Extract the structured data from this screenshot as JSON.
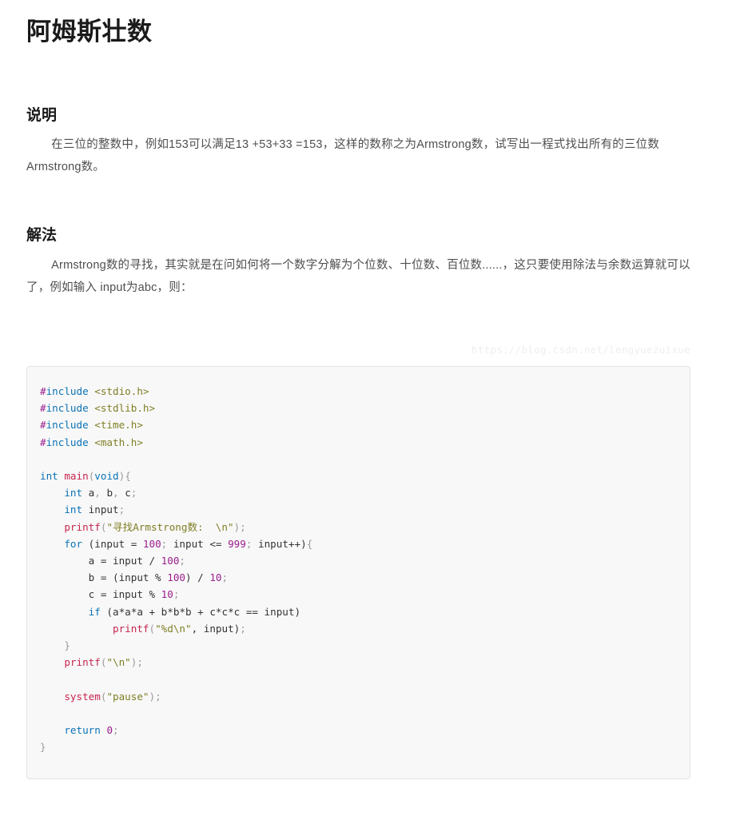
{
  "document": {
    "title": "阿姆斯壮数",
    "watermark": "https://blog.csdn.net/lengyuezuixue"
  },
  "sections": [
    {
      "heading": "说明",
      "paragraph": "在三位的整数中，例如153可以满足13 +53+33 =153，这样的数称之为Armstrong数，试写出一程式找出所有的三位数Armstrong数。"
    },
    {
      "heading": "解法",
      "paragraph": "Armstrong数的寻找，其实就是在问如何将一个数字分解为个位数、十位数、百位数......，这只要使用除法与余数运算就可以了，例如输入 input为abc，则："
    }
  ],
  "formula": {
    "line1": "a = input / 100",
    "line2": "b = (input%100) / 10",
    "line3": "c = input % 10"
  },
  "code": {
    "language": "c",
    "lines": [
      [
        {
          "t": "#",
          "c": "hash"
        },
        {
          "t": "include ",
          "c": "pre"
        },
        {
          "t": "<stdio.h>",
          "c": "inc"
        }
      ],
      [
        {
          "t": "#",
          "c": "hash"
        },
        {
          "t": "include ",
          "c": "pre"
        },
        {
          "t": "<stdlib.h>",
          "c": "inc"
        }
      ],
      [
        {
          "t": "#",
          "c": "hash"
        },
        {
          "t": "include ",
          "c": "pre"
        },
        {
          "t": "<time.h>",
          "c": "inc"
        }
      ],
      [
        {
          "t": "#",
          "c": "hash"
        },
        {
          "t": "include ",
          "c": "pre"
        },
        {
          "t": "<math.h>",
          "c": "inc"
        }
      ],
      [],
      [
        {
          "t": "int ",
          "c": "kw"
        },
        {
          "t": "main",
          "c": "fn"
        },
        {
          "t": "(",
          "c": "punct"
        },
        {
          "t": "void",
          "c": "kw"
        },
        {
          "t": ")",
          "c": "punct"
        },
        {
          "t": "{",
          "c": "brace"
        }
      ],
      [
        {
          "t": "    ",
          "c": "plain"
        },
        {
          "t": "int",
          "c": "kw"
        },
        {
          "t": " a",
          "c": "plain"
        },
        {
          "t": ",",
          "c": "punct"
        },
        {
          "t": " b",
          "c": "plain"
        },
        {
          "t": ",",
          "c": "punct"
        },
        {
          "t": " c",
          "c": "plain"
        },
        {
          "t": ";",
          "c": "punct"
        }
      ],
      [
        {
          "t": "    ",
          "c": "plain"
        },
        {
          "t": "int",
          "c": "kw"
        },
        {
          "t": " input",
          "c": "plain"
        },
        {
          "t": ";",
          "c": "punct"
        }
      ],
      [
        {
          "t": "    ",
          "c": "plain"
        },
        {
          "t": "printf",
          "c": "fn"
        },
        {
          "t": "(",
          "c": "punct"
        },
        {
          "t": "\"寻找Armstrong数:  \\n\"",
          "c": "str"
        },
        {
          "t": ")",
          "c": "punct"
        },
        {
          "t": ";",
          "c": "punct"
        }
      ],
      [
        {
          "t": "    ",
          "c": "plain"
        },
        {
          "t": "for",
          "c": "kw"
        },
        {
          "t": " (input = ",
          "c": "plain"
        },
        {
          "t": "100",
          "c": "num"
        },
        {
          "t": ";",
          "c": "punct"
        },
        {
          "t": " input <= ",
          "c": "plain"
        },
        {
          "t": "999",
          "c": "num"
        },
        {
          "t": ";",
          "c": "punct"
        },
        {
          "t": " input++)",
          "c": "plain"
        },
        {
          "t": "{",
          "c": "brace"
        }
      ],
      [
        {
          "t": "        a = input / ",
          "c": "plain"
        },
        {
          "t": "100",
          "c": "num"
        },
        {
          "t": ";",
          "c": "punct"
        }
      ],
      [
        {
          "t": "        b = (input % ",
          "c": "plain"
        },
        {
          "t": "100",
          "c": "num"
        },
        {
          "t": ") / ",
          "c": "plain"
        },
        {
          "t": "10",
          "c": "num"
        },
        {
          "t": ";",
          "c": "punct"
        }
      ],
      [
        {
          "t": "        c = input % ",
          "c": "plain"
        },
        {
          "t": "10",
          "c": "num"
        },
        {
          "t": ";",
          "c": "punct"
        }
      ],
      [
        {
          "t": "        ",
          "c": "plain"
        },
        {
          "t": "if",
          "c": "kw"
        },
        {
          "t": " (a*a*a + b*b*b + c*c*c == input)",
          "c": "plain"
        }
      ],
      [
        {
          "t": "            ",
          "c": "plain"
        },
        {
          "t": "printf",
          "c": "fn"
        },
        {
          "t": "(",
          "c": "punct"
        },
        {
          "t": "\"%d\\n\"",
          "c": "str"
        },
        {
          "t": ", input)",
          "c": "plain"
        },
        {
          "t": ";",
          "c": "punct"
        }
      ],
      [
        {
          "t": "    ",
          "c": "plain"
        },
        {
          "t": "}",
          "c": "brace"
        }
      ],
      [
        {
          "t": "    ",
          "c": "plain"
        },
        {
          "t": "printf",
          "c": "fn"
        },
        {
          "t": "(",
          "c": "punct"
        },
        {
          "t": "\"\\n\"",
          "c": "str"
        },
        {
          "t": ")",
          "c": "punct"
        },
        {
          "t": ";",
          "c": "punct"
        }
      ],
      [],
      [
        {
          "t": "    ",
          "c": "plain"
        },
        {
          "t": "system",
          "c": "fn"
        },
        {
          "t": "(",
          "c": "punct"
        },
        {
          "t": "\"pause\"",
          "c": "str"
        },
        {
          "t": ")",
          "c": "punct"
        },
        {
          "t": ";",
          "c": "punct"
        }
      ],
      [],
      [
        {
          "t": "    ",
          "c": "plain"
        },
        {
          "t": "return",
          "c": "kw"
        },
        {
          "t": " ",
          "c": "plain"
        },
        {
          "t": "0",
          "c": "num"
        },
        {
          "t": ";",
          "c": "punct"
        }
      ],
      [
        {
          "t": "}",
          "c": "brace"
        }
      ]
    ]
  },
  "colors": {
    "page_background": "#ffffff",
    "body_text": "#4f4f4f",
    "heading_text": "#1a1a1a",
    "code_background": "#f8f8f8",
    "code_border": "#e3e3e3",
    "watermark": "#eceff1",
    "keyword": "#0b72b5",
    "function": "#c7254e",
    "string": "#7f7f26",
    "number": "#9b1d8e",
    "preprocessor_hash": "#9b1d8e"
  }
}
